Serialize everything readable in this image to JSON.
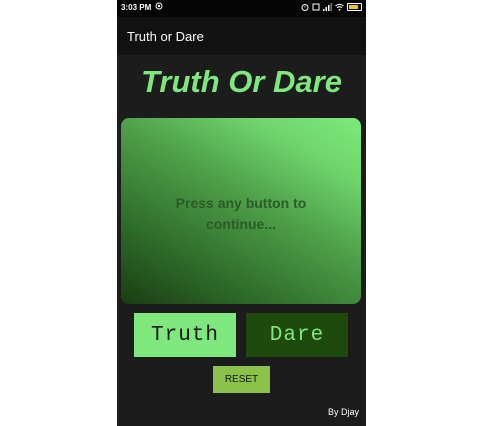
{
  "status_bar": {
    "time": "3:03 PM",
    "notification_icon": "app-notification-icon",
    "alarm_icon": "alarm-icon",
    "sim_icon": "sim-icon",
    "signal_icon": "signal-icon",
    "wifi_icon": "wifi-icon",
    "battery_icon": "battery-icon"
  },
  "app_bar": {
    "title": "Truth or Dare"
  },
  "main": {
    "headline": "Truth Or Dare",
    "message_line1": "Press any button to",
    "message_line2": "continue...",
    "truth_label": "Truth",
    "dare_label": "Dare",
    "reset_label": "RESET",
    "footer": "By Djay"
  },
  "colors": {
    "background": "#1c1c1c",
    "accent_green": "#7ee87e",
    "dark_green": "#1f4a0d",
    "reset_green": "#8bc34a"
  }
}
